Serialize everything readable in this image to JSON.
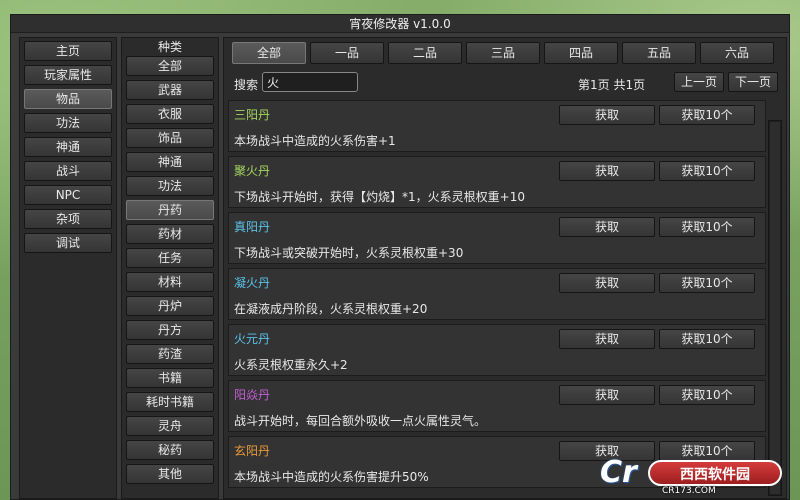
{
  "window": {
    "title": "宵夜修改器 v1.0.0"
  },
  "nav_main": [
    {
      "label": "主页",
      "selected": false
    },
    {
      "label": "玩家属性",
      "selected": false
    },
    {
      "label": "物品",
      "selected": true
    },
    {
      "label": "功法",
      "selected": false
    },
    {
      "label": "神通",
      "selected": false
    },
    {
      "label": "战斗",
      "selected": false
    },
    {
      "label": "NPC",
      "selected": false
    },
    {
      "label": "杂项",
      "selected": false
    },
    {
      "label": "调试",
      "selected": false
    }
  ],
  "category": {
    "header": "种类",
    "items": [
      {
        "label": "全部",
        "selected": false
      },
      {
        "label": "武器",
        "selected": false
      },
      {
        "label": "衣服",
        "selected": false
      },
      {
        "label": "饰品",
        "selected": false
      },
      {
        "label": "神通",
        "selected": false
      },
      {
        "label": "功法",
        "selected": false
      },
      {
        "label": "丹药",
        "selected": true
      },
      {
        "label": "药材",
        "selected": false
      },
      {
        "label": "任务",
        "selected": false
      },
      {
        "label": "材料",
        "selected": false
      },
      {
        "label": "丹炉",
        "selected": false
      },
      {
        "label": "丹方",
        "selected": false
      },
      {
        "label": "药渣",
        "selected": false
      },
      {
        "label": "书籍",
        "selected": false
      },
      {
        "label": "耗时书籍",
        "selected": false
      },
      {
        "label": "灵舟",
        "selected": false
      },
      {
        "label": "秘药",
        "selected": false
      },
      {
        "label": "其他",
        "selected": false
      }
    ]
  },
  "grade_tabs": [
    {
      "label": "全部",
      "selected": true
    },
    {
      "label": "一品",
      "selected": false
    },
    {
      "label": "二品",
      "selected": false
    },
    {
      "label": "三品",
      "selected": false
    },
    {
      "label": "四品",
      "selected": false
    },
    {
      "label": "五品",
      "selected": false
    },
    {
      "label": "六品",
      "selected": false
    }
  ],
  "search": {
    "label": "搜索",
    "value": "火",
    "page_info": "第1页 共1页",
    "prev_label": "上一页",
    "next_label": "下一页"
  },
  "items": [
    {
      "name": "三阳丹",
      "color": "#a4d65e",
      "desc": "本场战斗中造成的火系伤害+1",
      "get_label": "获取",
      "get10_label": "获取10个"
    },
    {
      "name": "聚火丹",
      "color": "#a4d65e",
      "desc": "下场战斗开始时，获得【灼烧】*1，火系灵根权重+10",
      "get_label": "获取",
      "get10_label": "获取10个"
    },
    {
      "name": "真阳丹",
      "color": "#5bc3e8",
      "desc": "下场战斗或突破开始时，火系灵根权重+30",
      "get_label": "获取",
      "get10_label": "获取10个"
    },
    {
      "name": "凝火丹",
      "color": "#5bc3e8",
      "desc": "在凝液成丹阶段，火系灵根权重+20",
      "get_label": "获取",
      "get10_label": "获取10个"
    },
    {
      "name": "火元丹",
      "color": "#5bc3e8",
      "desc": "火系灵根权重永久+2",
      "get_label": "获取",
      "get10_label": "获取10个"
    },
    {
      "name": "阳焱丹",
      "color": "#c25fd6",
      "desc": "战斗开始时，每回合额外吸收一点火属性灵气。",
      "get_label": "获取",
      "get10_label": "获取10个"
    },
    {
      "name": "玄阳丹",
      "color": "#e89a3a",
      "desc": "本场战斗中造成的火系伤害提升50%",
      "get_label": "获取",
      "get10_label": "获取10个"
    }
  ],
  "watermark": {
    "logo": "Cr",
    "text": "西西软件园",
    "url": "CR173.COM"
  }
}
